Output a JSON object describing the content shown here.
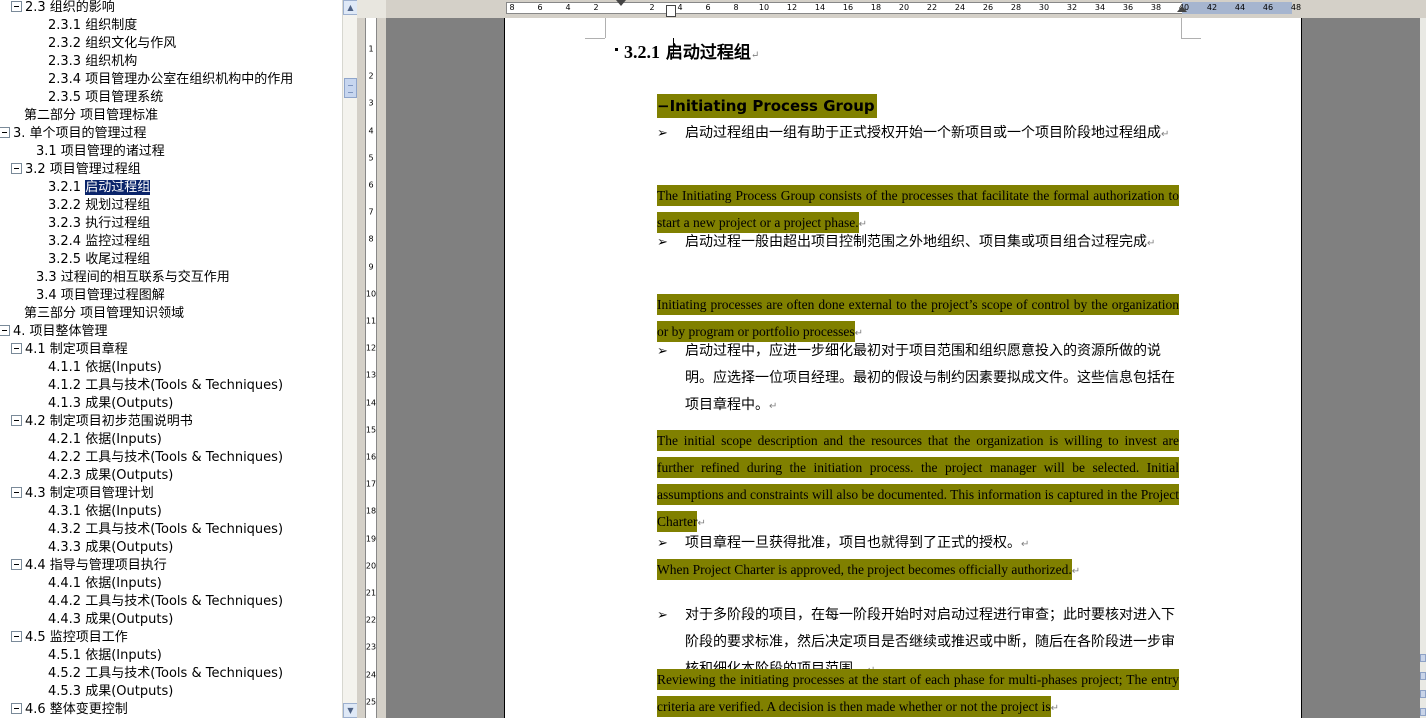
{
  "document_map": {
    "items": [
      {
        "label": "2.3 组织的影响",
        "indent": 1,
        "toggle": true
      },
      {
        "label": "2.3.1 组织制度",
        "indent": 3,
        "toggle": false
      },
      {
        "label": "2.3.2 组织文化与作风",
        "indent": 3,
        "toggle": false
      },
      {
        "label": "2.3.3 组织机构",
        "indent": 3,
        "toggle": false
      },
      {
        "label": "2.3.4 项目管理办公室在组织机构中的作用",
        "indent": 3,
        "toggle": false
      },
      {
        "label": "2.3.5 项目管理系统",
        "indent": 3,
        "toggle": false
      },
      {
        "label": "第二部分  项目管理标准",
        "indent": 1,
        "toggle": false
      },
      {
        "label": "3. 单个项目的管理过程",
        "indent": 0,
        "toggle": true
      },
      {
        "label": "3.1 项目管理的诸过程",
        "indent": 2,
        "toggle": false
      },
      {
        "label": "3.2 项目管理过程组",
        "indent": 1,
        "toggle": true
      },
      {
        "label": "3.2.1 启动过程组",
        "indent": 3,
        "toggle": false,
        "selected": true,
        "num": "3.2.1 ",
        "sel_text": "启动过程组"
      },
      {
        "label": "3.2.2 规划过程组",
        "indent": 3,
        "toggle": false
      },
      {
        "label": "3.2.3 执行过程组",
        "indent": 3,
        "toggle": false
      },
      {
        "label": "3.2.4 监控过程组",
        "indent": 3,
        "toggle": false
      },
      {
        "label": "3.2.5 收尾过程组",
        "indent": 3,
        "toggle": false
      },
      {
        "label": "3.3 过程间的相互联系与交互作用",
        "indent": 2,
        "toggle": false
      },
      {
        "label": "3.4 项目管理过程图解",
        "indent": 2,
        "toggle": false
      },
      {
        "label": "第三部分  项目管理知识领域",
        "indent": 1,
        "toggle": false
      },
      {
        "label": "4. 项目整体管理",
        "indent": 0,
        "toggle": true
      },
      {
        "label": "4.1 制定项目章程",
        "indent": 1,
        "toggle": true
      },
      {
        "label": "4.1.1 依据(Inputs)",
        "indent": 3,
        "toggle": false
      },
      {
        "label": "4.1.2 工具与技术(Tools & Techniques)",
        "indent": 3,
        "toggle": false
      },
      {
        "label": "4.1.3 成果(Outputs)",
        "indent": 3,
        "toggle": false
      },
      {
        "label": "4.2 制定项目初步范围说明书",
        "indent": 1,
        "toggle": true
      },
      {
        "label": "4.2.1 依据(Inputs)",
        "indent": 3,
        "toggle": false
      },
      {
        "label": "4.2.2 工具与技术(Tools & Techniques)",
        "indent": 3,
        "toggle": false
      },
      {
        "label": "4.2.3 成果(Outputs)",
        "indent": 3,
        "toggle": false
      },
      {
        "label": "4.3 制定项目管理计划",
        "indent": 1,
        "toggle": true
      },
      {
        "label": "4.3.1 依据(Inputs)",
        "indent": 3,
        "toggle": false
      },
      {
        "label": "4.3.2 工具与技术(Tools & Techniques)",
        "indent": 3,
        "toggle": false
      },
      {
        "label": "4.3.3 成果(Outputs)",
        "indent": 3,
        "toggle": false
      },
      {
        "label": "4.4 指导与管理项目执行",
        "indent": 1,
        "toggle": true
      },
      {
        "label": "4.4.1 依据(Inputs)",
        "indent": 3,
        "toggle": false
      },
      {
        "label": "4.4.2 工具与技术(Tools & Techniques)",
        "indent": 3,
        "toggle": false
      },
      {
        "label": "4.4.3 成果(Outputs)",
        "indent": 3,
        "toggle": false
      },
      {
        "label": "4.5 监控项目工作",
        "indent": 1,
        "toggle": true
      },
      {
        "label": "4.5.1 依据(Inputs)",
        "indent": 3,
        "toggle": false
      },
      {
        "label": "4.5.2 工具与技术(Tools & Techniques)",
        "indent": 3,
        "toggle": false
      },
      {
        "label": "4.5.3 成果(Outputs)",
        "indent": 3,
        "toggle": false
      },
      {
        "label": "4.6 整体变更控制",
        "indent": 1,
        "toggle": true
      }
    ]
  },
  "ruler": {
    "tab_stop_symbol": "L",
    "h_ticks": [
      "8",
      "6",
      "4",
      "2",
      "2",
      "4",
      "6",
      "8",
      "10",
      "12",
      "14",
      "16",
      "18",
      "20",
      "22",
      "24",
      "26",
      "28",
      "30",
      "32",
      "34",
      "36",
      "38",
      "40",
      "42",
      "44",
      "46",
      "48"
    ],
    "v_ticks": [
      "1",
      "2",
      "3",
      "4",
      "5",
      "6",
      "7",
      "8",
      "9",
      "10",
      "11",
      "12",
      "13",
      "14",
      "15",
      "16",
      "17",
      "18",
      "19",
      "20",
      "21",
      "22",
      "23",
      "24",
      "25"
    ]
  },
  "document": {
    "heading_number": "3.2.1",
    "heading_title": "启动过程组",
    "paragraph_mark": "↵",
    "process_group_title": "Initiating Process Group",
    "bullet_symbol": "➢",
    "paragraphs": [
      {
        "type": "cn",
        "text": "启动过程组由一组有助于正式授权开始一个新项目或一个项目阶段地过程组成"
      },
      {
        "type": "en",
        "text": "The Initiating Process Group consists of the processes that facilitate the formal authorization to start a new project or a project phase."
      },
      {
        "type": "cn",
        "text": "启动过程一般由超出项目控制范围之外地组织、项目集或项目组合过程完成"
      },
      {
        "type": "en",
        "text": "Initiating processes are often done external to the project’s scope of control by the organization or by program or portfolio processes"
      },
      {
        "type": "cn",
        "text": "启动过程中，应进一步细化最初对于项目范围和组织愿意投入的资源所做的说明。应选择一位项目经理。最初的假设与制约因素要拟成文件。这些信息包括在项目章程中。"
      },
      {
        "type": "en",
        "text": "The initial scope description and the resources that the organization is willing to invest are further refined during the initiation process. the project manager will be selected. Initial assumptions and constraints will also be documented. This information is captured in the Project Charter"
      },
      {
        "type": "cn",
        "text": "项目章程一旦获得批准，项目也就得到了正式的授权。"
      },
      {
        "type": "en",
        "text": "When Project Charter is approved, the project becomes officially authorized."
      },
      {
        "type": "cn",
        "text": "对于多阶段的项目，在每一阶段开始时对启动过程进行审查；此时要核对进入下阶段的要求标准，然后决定项目是否继续或推迟或中断，随后在各阶段进一步审核和细化本阶段的项目范围。"
      },
      {
        "type": "en",
        "text": "Reviewing the initiating processes at the start of each phase for multi-phases project; The entry criteria are verified. A decision is then made whether or not the project is"
      }
    ]
  },
  "colors": {
    "highlight": "#808000",
    "selection": "#0a246a",
    "app_gray": "#808080"
  }
}
